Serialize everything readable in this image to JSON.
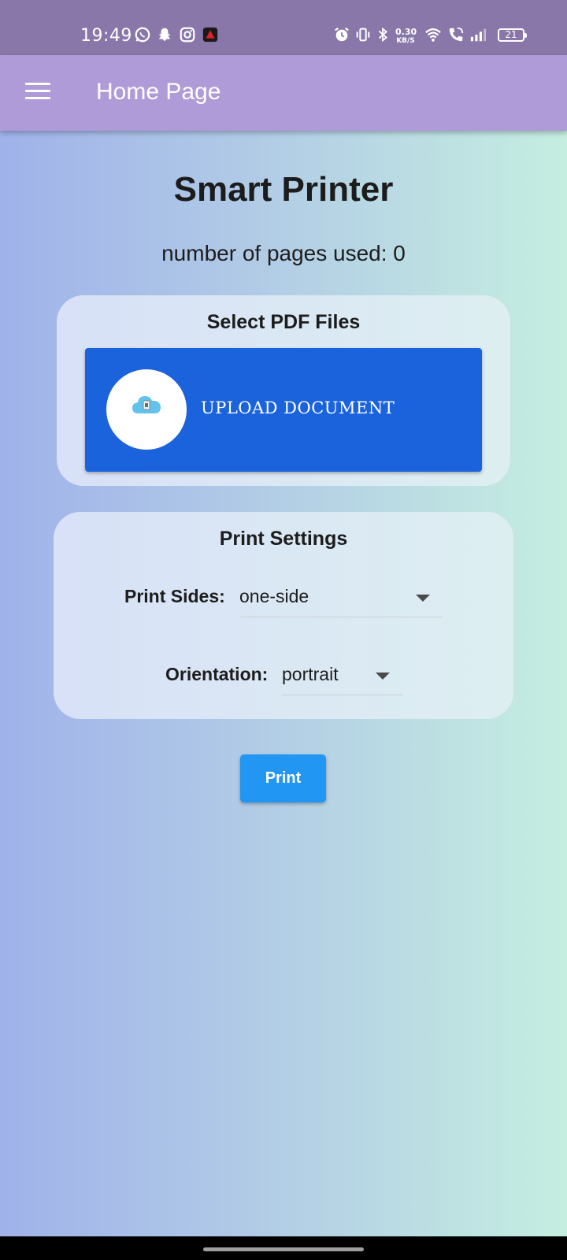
{
  "status_bar": {
    "time": "19:49",
    "net_speed_value": "0.30",
    "net_speed_unit": "KB/S",
    "battery_level": "21",
    "icons": [
      "whatsapp-icon",
      "snapchat-icon",
      "instagram-icon",
      "app-alert-icon",
      "alarm-icon",
      "vibrate-icon",
      "bluetooth-icon",
      "wifi-icon",
      "wifi-call-icon",
      "signal-icon",
      "battery-icon"
    ]
  },
  "app_bar": {
    "title": "Home Page",
    "menu_icon": "hamburger-menu-icon"
  },
  "main": {
    "title": "Smart Printer",
    "pages_used": "number of pages used: 0"
  },
  "upload_card": {
    "title": "Select PDF Files",
    "button_label": "UPLOAD DOCUMENT",
    "button_icon": "cloud-upload-icon"
  },
  "settings_card": {
    "title": "Print Settings",
    "print_sides_label": "Print Sides:",
    "print_sides_value": "one-side",
    "orientation_label": "Orientation:",
    "orientation_value": "portrait"
  },
  "actions": {
    "print_label": "Print"
  },
  "colors": {
    "status_bar": "#8877a8",
    "app_bar": "#ae9bd7",
    "upload_button": "#1b63dc",
    "print_button": "#2196f3"
  }
}
